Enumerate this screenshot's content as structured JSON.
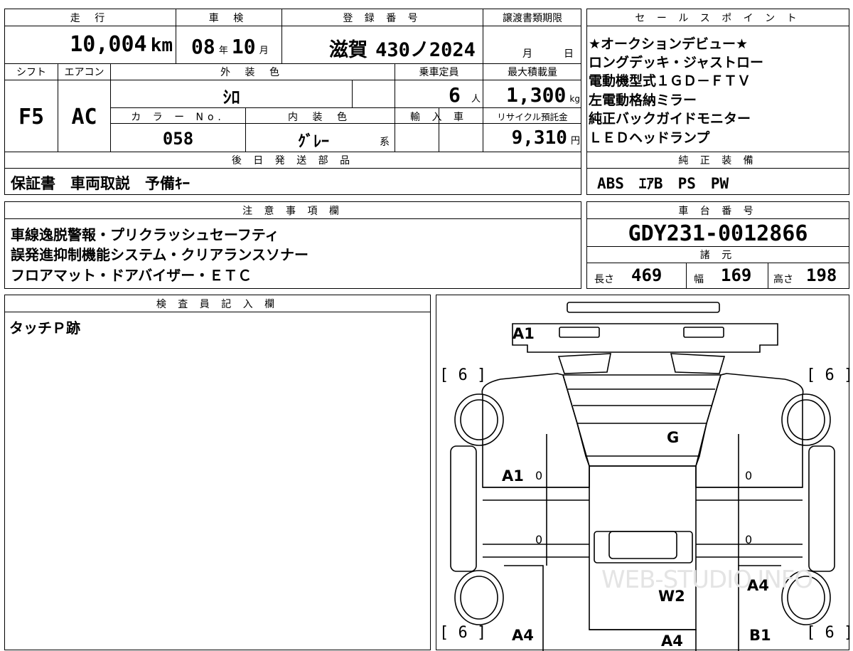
{
  "top_info": {
    "mileage_header": "走 行",
    "mileage": "10,004",
    "mileage_unit": "km",
    "inspection_header": "車 検",
    "inspection_year": "08",
    "inspection_year_unit": "年",
    "inspection_month": "10",
    "inspection_month_unit": "月",
    "registration_header": "登 録 番 号",
    "registration_place": "滋賀",
    "registration_number": "430ノ2024",
    "transfer_header": "譲渡書類期限",
    "transfer_month_unit": "月",
    "transfer_day_unit": "日"
  },
  "spec": {
    "shift_header": "シフト",
    "shift": "F5",
    "ac_header": "エアコン",
    "ac": "AC",
    "exterior_color_header": "外 装 色",
    "exterior_color": "ｼﾛ",
    "capacity_header": "乗車定員",
    "capacity": "6",
    "capacity_unit": "人",
    "max_load_header": "最大積載量",
    "max_load": "1,300",
    "max_load_unit": "kg",
    "color_no_header": "カ ラ ー No.",
    "color_no": "058",
    "interior_color_header": "内 装 色",
    "interior_color": "ｸﾞﾚｰ",
    "interior_color_suffix": "系",
    "import_header": "輸 入 車",
    "recycle_header": "リサイクル預託金",
    "recycle_fee": "9,310",
    "recycle_unit": "円"
  },
  "later_parts": {
    "header": "後 日 発 送 部 品",
    "value": "保証書　車両取説　予備ｷｰ"
  },
  "sales_points": {
    "header": "セ ー ル ス ポ イ ン ト",
    "lines": [
      "★オークションデビュー★",
      "ロングデッキ・ジャストロー",
      "電動機型式１ＧＤ－ＦＴＶ",
      "左電動格納ミラー",
      "純正バックガイドモニター",
      "ＬＥＤヘッドランプ"
    ]
  },
  "equipment": {
    "header": "純 正 装 備",
    "value": "ABS　ｴｱB　PS　PW"
  },
  "notes": {
    "header": "注 意 事 項 欄",
    "lines": [
      "車線逸脱警報・プリクラッシュセーフティ",
      "誤発進抑制機能システム・クリアランスソナー",
      "フロアマット・ドアバイザー・ＥＴＣ"
    ]
  },
  "chassis": {
    "header": "車 台 番 号",
    "value": "GDY231-0012866"
  },
  "dimensions": {
    "header": "諸 元",
    "length_label": "長さ",
    "length": "469",
    "width_label": "幅",
    "width": "169",
    "height_label": "高さ",
    "height": "198"
  },
  "inspector": {
    "header": "検 査 員 記 入 欄",
    "note": "タッチＰ跡"
  },
  "diagram": {
    "marks": {
      "front_bumper": "A1",
      "tire_front_left": "[ 6 ]",
      "tire_front_right": "[ 6 ]",
      "windshield": "G",
      "left_door_front": "A1",
      "left_door_front_zero": "0",
      "right_door_front_zero": "0",
      "left_door_rear_zero": "0",
      "right_door_rear_zero": "0",
      "roof": "W2",
      "right_rear_panel": "A4",
      "tire_rear_left": "[ 6 ]",
      "tire_rear_right": "[ 6 ]",
      "left_bed": "A4",
      "rear_center": "A4",
      "right_bed": "B1"
    },
    "watermark": "WEB-STUDIO.INFO"
  }
}
